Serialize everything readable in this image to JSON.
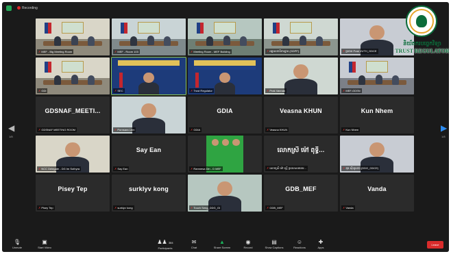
{
  "topbar": {
    "recording": "Recording"
  },
  "tiles": [
    {
      "label": "MEF - Big Meeting Room",
      "kind": "video",
      "scene": "room"
    },
    {
      "label": "MEF - Room 103",
      "kind": "video",
      "scene": "room"
    },
    {
      "label": "Meeting Room - MEF Building",
      "kind": "video",
      "scene": "room"
    },
    {
      "label": "អគ្គលេខាធិការដ្ឋាន (GDPF)",
      "kind": "video",
      "scene": "room"
    },
    {
      "label": "ប្រធាន Prak VUTH_GDCE",
      "kind": "video",
      "scene": "person"
    },
    {
      "label": "GDI",
      "kind": "video",
      "scene": "room"
    },
    {
      "label": "SEC",
      "kind": "video",
      "scene": "banner",
      "active": true
    },
    {
      "label": "Trust Regulator",
      "kind": "video",
      "scene": "banner"
    },
    {
      "label": "Prak Vannak",
      "kind": "video",
      "scene": "person"
    },
    {
      "label": "MEF-GDSN",
      "kind": "video",
      "scene": "room"
    },
    {
      "label": "GDSNAF MEETING ROOM",
      "name": "GDSNAF_MEETI...",
      "kind": "name"
    },
    {
      "label": "Pornsara Lem",
      "kind": "video",
      "scene": "person"
    },
    {
      "label": "GDIA",
      "name": "GDIA",
      "kind": "name"
    },
    {
      "label": "Veasna KHUN",
      "name": "Veasna KHUN",
      "kind": "name"
    },
    {
      "label": "Kun Nhem",
      "name": "Kun Nhem",
      "kind": "name"
    },
    {
      "label": "NCC Delegate - DG Im Sothyra",
      "kind": "video",
      "scene": "person"
    },
    {
      "label": "Say Ean",
      "name": "Say Ean",
      "kind": "name"
    },
    {
      "label": "Ramnesa Din - D MEF",
      "kind": "video",
      "scene": "poster"
    },
    {
      "label": "លោកស្រី ម៉ៅ ពុទ្ធី ប្រធានសមាគម...",
      "name": "លោកស្រី ម៉ៅ ពុទ្ធី...",
      "kind": "name"
    },
    {
      "label": "ឌុង ស៊ីយូសាង (DDG_GDCE)",
      "kind": "video",
      "scene": "person"
    },
    {
      "label": "Pisey Tep",
      "name": "Pisey Tep",
      "kind": "name"
    },
    {
      "label": "surklyv kong",
      "name": "surklyv kong",
      "kind": "name"
    },
    {
      "label": "Touch Seng_DDG_GI",
      "kind": "video",
      "scene": "person"
    },
    {
      "label": "GDB_MEF",
      "name": "GDB_MEF",
      "kind": "name"
    },
    {
      "label": "Vanda",
      "name": "Vanda",
      "kind": "name"
    }
  ],
  "pager": {
    "left": "1/8",
    "right": "1/8"
  },
  "logo": {
    "kh": "និយ័តករបច្ចេកវិទ្យា",
    "en": "TRUST REGULATOR"
  },
  "toolbar": {
    "unmute": "Unmute",
    "start_video": "Start Video",
    "participants": "Participants",
    "participants_count": "384",
    "chat": "Chat",
    "share_screen": "Share Screen",
    "record": "Record",
    "show_captions": "Show Captions",
    "reactions": "Reactions",
    "apps": "Apps",
    "leave": "Leave"
  },
  "colors": {
    "leave": "#d92c2c",
    "share": "#1bb55c",
    "accent_arrow": "#2d8cf0"
  }
}
